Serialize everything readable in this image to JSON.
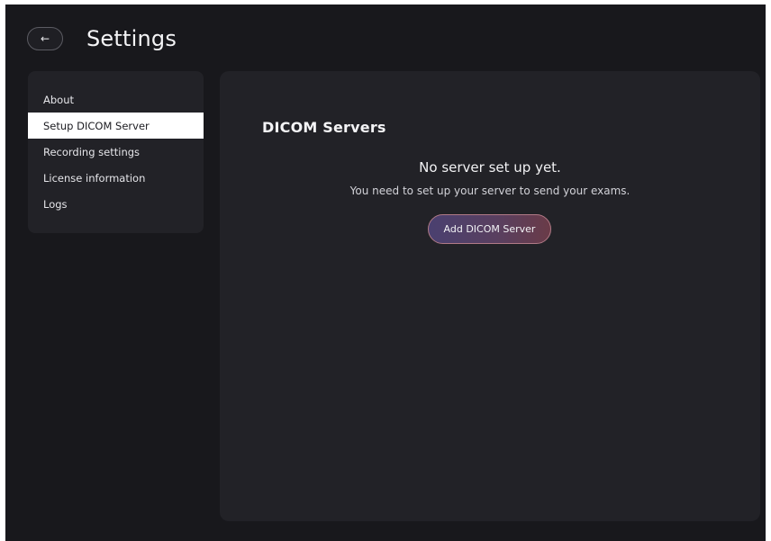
{
  "header": {
    "back_icon": "←",
    "title": "Settings"
  },
  "sidebar": {
    "items": [
      {
        "label": "About",
        "active": false
      },
      {
        "label": "Setup DICOM Server",
        "active": true
      },
      {
        "label": "Recording settings",
        "active": false
      },
      {
        "label": "License information",
        "active": false
      },
      {
        "label": "Logs",
        "active": false
      }
    ]
  },
  "main": {
    "section_title": "DICOM Servers",
    "empty_title": "No server set up yet.",
    "empty_subtitle": "You need to set up your server to send your exams.",
    "add_button_label": "Add DICOM Server"
  },
  "colors": {
    "background": "#18181c",
    "panel": "#222227",
    "active_item": "#ffffff",
    "button_gradient_start": "#4a4070",
    "button_gradient_end": "#6a3b48"
  }
}
